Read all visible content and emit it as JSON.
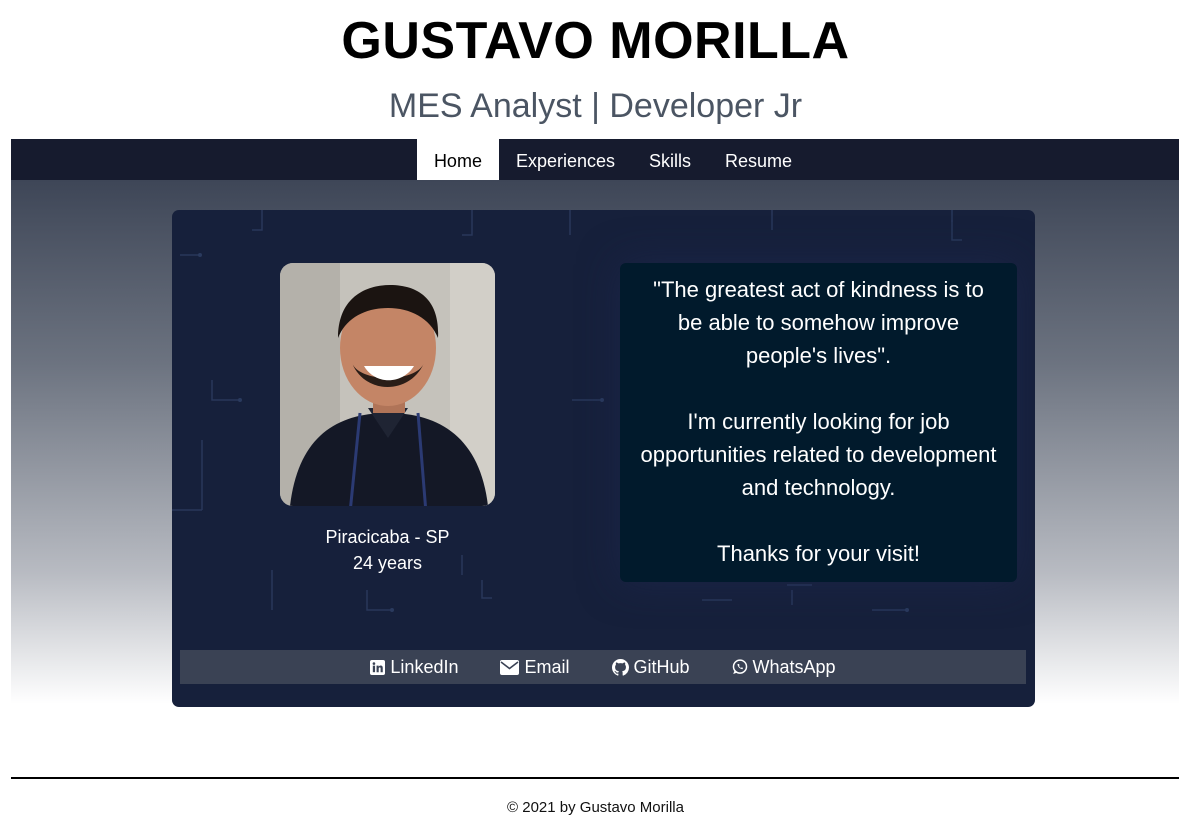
{
  "header": {
    "name": "GUSTAVO MORILLA",
    "subtitle": "MES Analyst | Developer Jr"
  },
  "nav": {
    "items": [
      {
        "label": "Home",
        "active": true
      },
      {
        "label": "Experiences",
        "active": false
      },
      {
        "label": "Skills",
        "active": false
      },
      {
        "label": "Resume",
        "active": false
      }
    ]
  },
  "profile": {
    "location": "Piracicaba - SP",
    "age": "24 years"
  },
  "quote": {
    "text": "\"The greatest act of kindness is to be able to somehow improve people's lives\".",
    "looking": "I'm currently looking for job opportunities related to development and technology.",
    "thanks": "Thanks for your visit!"
  },
  "links": [
    {
      "label": "LinkedIn",
      "icon": "linkedin-icon"
    },
    {
      "label": "Email",
      "icon": "envelope-icon"
    },
    {
      "label": "GitHub",
      "icon": "github-icon"
    },
    {
      "label": "WhatsApp",
      "icon": "whatsapp-icon"
    }
  ],
  "footer": {
    "text": "© 2021 by Gustavo Morilla"
  },
  "colors": {
    "nav_bg": "#161b2e",
    "card_bg": "#16203b",
    "quote_bg": "#011a2c",
    "links_bar_bg": "#3a4254",
    "subtitle": "#4b5563"
  }
}
